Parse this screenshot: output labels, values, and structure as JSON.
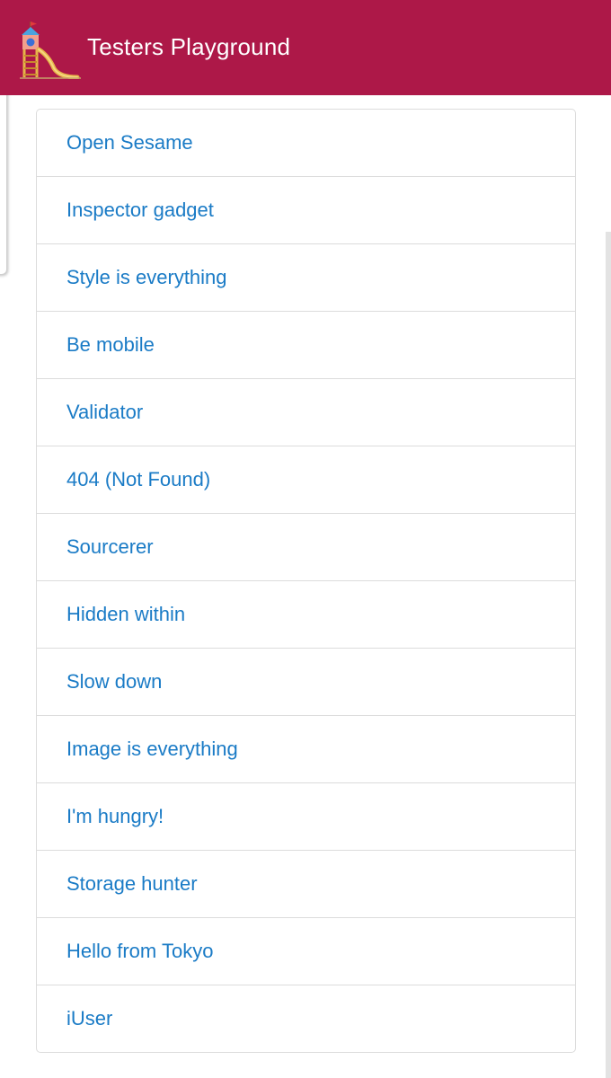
{
  "header": {
    "title": "Testers Playground",
    "background_color": "#ad1848",
    "logo_icon": "playground-slide-icon"
  },
  "menu": {
    "link_color": "#1a7bc6",
    "items": [
      {
        "label": "Open Sesame"
      },
      {
        "label": "Inspector gadget"
      },
      {
        "label": "Style is everything"
      },
      {
        "label": "Be mobile"
      },
      {
        "label": "Validator"
      },
      {
        "label": "404 (Not Found)"
      },
      {
        "label": "Sourcerer"
      },
      {
        "label": "Hidden within"
      },
      {
        "label": "Slow down"
      },
      {
        "label": "Image is everything"
      },
      {
        "label": "I'm hungry!"
      },
      {
        "label": "Storage hunter"
      },
      {
        "label": "Hello from Tokyo"
      },
      {
        "label": "iUser"
      }
    ]
  }
}
